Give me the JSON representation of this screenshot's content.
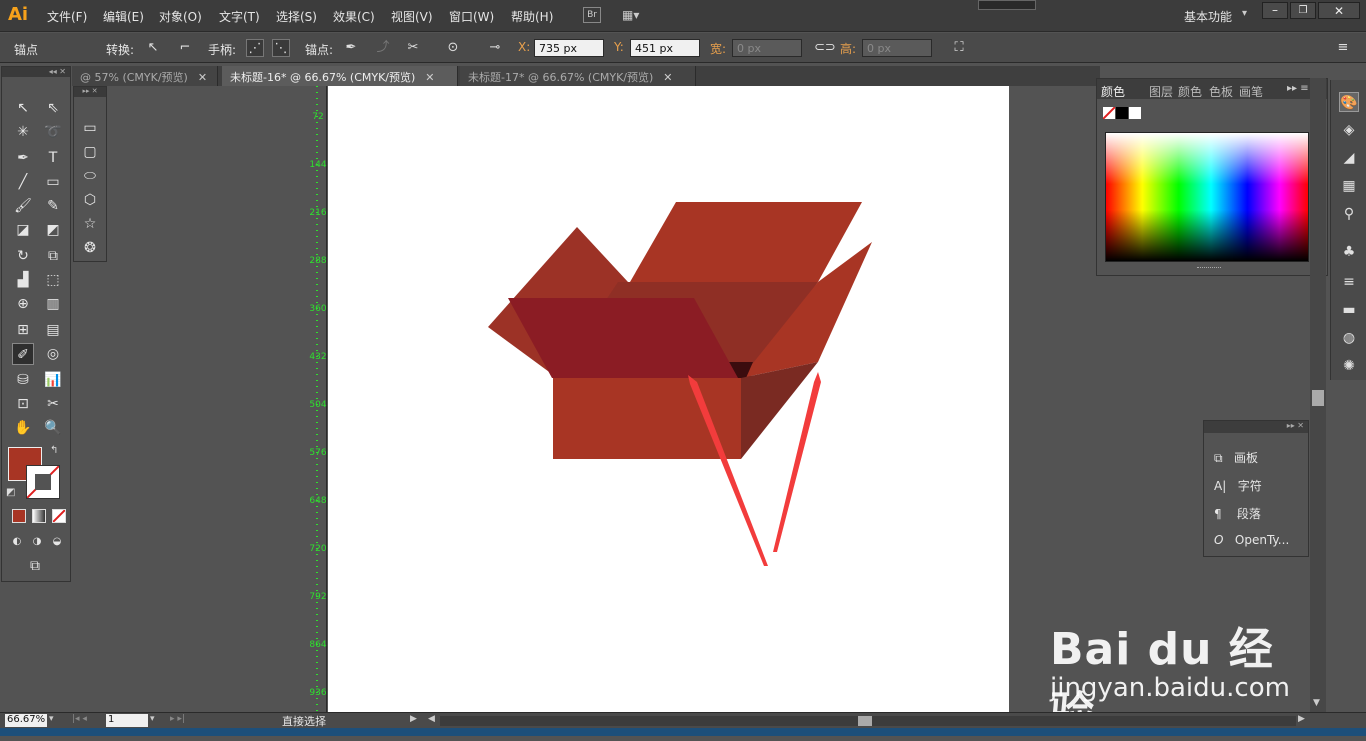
{
  "app": {
    "logo": "Ai"
  },
  "menubar": {
    "items": [
      "文件(F)",
      "编辑(E)",
      "对象(O)",
      "文字(T)",
      "选择(S)",
      "效果(C)",
      "视图(V)",
      "窗口(W)",
      "帮助(H)"
    ],
    "br_label": "Br",
    "workspace": "基本功能"
  },
  "control": {
    "anchor_label": "锚点",
    "convert_label": "转换:",
    "handles_label": "手柄:",
    "anchors_label": "锚点:",
    "x_label": "X:",
    "x_value": "735 px",
    "y_label": "Y:",
    "y_value": "451 px",
    "w_label": "宽:",
    "w_value": "0 px",
    "h_label": "高:",
    "h_value": "0 px"
  },
  "tabs": [
    {
      "label": "@ 57% (CMYK/预览)",
      "active": false
    },
    {
      "label": "未标题-16* @ 66.67% (CMYK/预览)",
      "active": true
    },
    {
      "label": "未标题-17* @ 66.67% (CMYK/预览)",
      "active": false
    }
  ],
  "ruler_ticks": [
    "72",
    "144",
    "216",
    "288",
    "360",
    "432",
    "504",
    "576",
    "648",
    "720",
    "792",
    "864",
    "936"
  ],
  "color_panel": {
    "tabs": [
      "颜色",
      "图层",
      "颜色",
      "色板",
      "画笔"
    ]
  },
  "char_panel": {
    "items": [
      {
        "icon": "artboard-icon",
        "label": "画板"
      },
      {
        "icon": "character-icon",
        "label": "字符"
      },
      {
        "icon": "paragraph-icon",
        "label": "段落"
      },
      {
        "icon": "opentype-icon",
        "label": "OpenTy..."
      }
    ]
  },
  "status": {
    "zoom": "66.67%",
    "artboard_num": "1",
    "tool_name": "直接选择"
  },
  "watermark": {
    "brand": "Bai du 经验",
    "url": "jingyan.baidu.com"
  },
  "colors": {
    "fill": "#a83524",
    "box_front": "#a83524",
    "box_side": "#7a2a22",
    "flap_dark": "#8b1c24",
    "arrow": "#f23c3c"
  }
}
